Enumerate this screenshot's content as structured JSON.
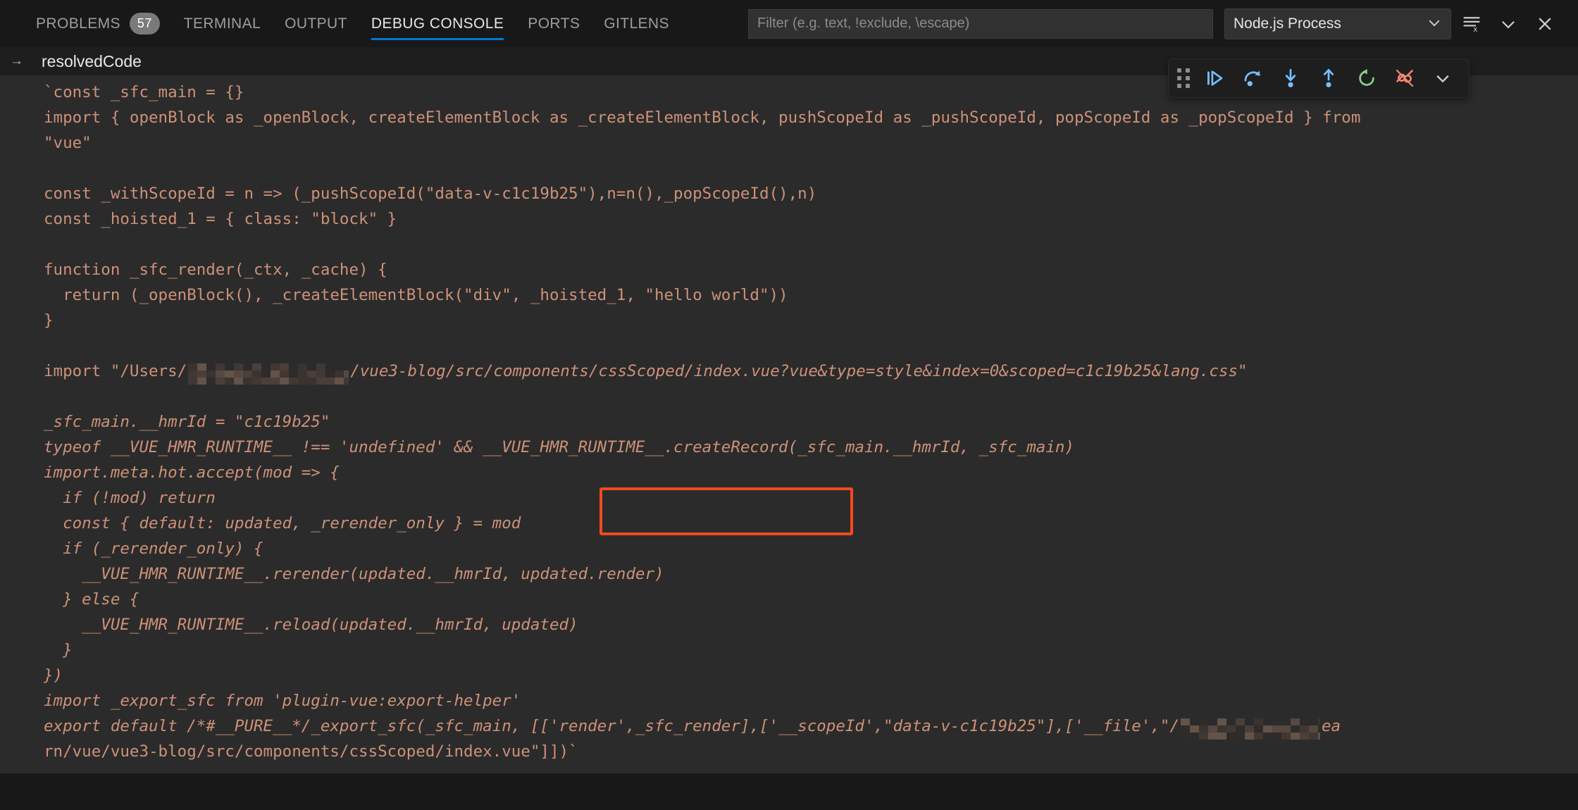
{
  "panel": {
    "tabs": [
      {
        "label": "PROBLEMS",
        "badge": "57",
        "active": false
      },
      {
        "label": "TERMINAL",
        "badge": null,
        "active": false
      },
      {
        "label": "OUTPUT",
        "badge": null,
        "active": false
      },
      {
        "label": "DEBUG CONSOLE",
        "badge": null,
        "active": true
      },
      {
        "label": "PORTS",
        "badge": null,
        "active": false
      },
      {
        "label": "GITLENS",
        "badge": null,
        "active": false
      }
    ],
    "filter": {
      "placeholder": "Filter (e.g. text, !exclude, \\escape)",
      "value": ""
    },
    "session": {
      "value": "Node.js Process",
      "chevron": "∨"
    },
    "actions": {
      "clear_console": "clear-console-icon",
      "more": "chevron-down-icon",
      "close": "close-icon"
    },
    "accent_color": "#0078d4",
    "badge_color": "#7a7a7a"
  },
  "debug_toolbar": {
    "grip": "drag-handle-icon",
    "buttons": [
      {
        "name": "continue-button",
        "title": "Continue",
        "color": "#75beff"
      },
      {
        "name": "step-over-button",
        "title": "Step Over",
        "color": "#75beff"
      },
      {
        "name": "step-into-button",
        "title": "Step Into",
        "color": "#75beff"
      },
      {
        "name": "step-out-button",
        "title": "Step Out",
        "color": "#75beff"
      },
      {
        "name": "restart-button",
        "title": "Restart",
        "color": "#89d185"
      },
      {
        "name": "disconnect-button",
        "title": "Disconnect",
        "color": "#f48771"
      },
      {
        "name": "toolbar-more-button",
        "title": "More",
        "color": "#cccccc"
      }
    ]
  },
  "console": {
    "expression": {
      "arrow": "→",
      "label": "resolvedCode"
    },
    "text_color": "#ce9178",
    "background": "#2b2b2b",
    "highlight": {
      "color": "#f4491e",
      "target": ",['__scopeId',\"data-v-c1c19b25\"]"
    },
    "lines": [
      {
        "text": "`const _sfc_main = {}",
        "italic": false
      },
      {
        "text": "import { openBlock as _openBlock, createElementBlock as _createElementBlock, pushScopeId as _pushScopeId, popScopeId as _popScopeId } from",
        "italic": false
      },
      {
        "text": "\"vue\"",
        "italic": false
      },
      {
        "text": "",
        "italic": false
      },
      {
        "text": "const _withScopeId = n => (_pushScopeId(\"data-v-c1c19b25\"),n=n(),_popScopeId(),n)",
        "italic": false
      },
      {
        "text": "const _hoisted_1 = { class: \"block\" }",
        "italic": false
      },
      {
        "text": "",
        "italic": false
      },
      {
        "text": "function _sfc_render(_ctx, _cache) {",
        "italic": false
      },
      {
        "text": "  return (_openBlock(), _createElementBlock(\"div\", _hoisted_1, \"hello world\"))",
        "italic": false
      },
      {
        "text": "}",
        "italic": false
      },
      {
        "text": "",
        "italic": false
      },
      {
        "text": "import \"/Users/",
        "italic": false,
        "redacted": true,
        "after": "/vue3-blog/src/components/cssScoped/index.vue?vue&type=style&index=0&scoped=c1c19b25&lang.css\"",
        "after_italic": true
      },
      {
        "text": "",
        "italic": false
      },
      {
        "text": "_sfc_main.__hmrId = \"c1c19b25\"",
        "italic": true
      },
      {
        "text": "typeof __VUE_HMR_RUNTIME__ !== 'undefined' && __VUE_HMR_RUNTIME__.createRecord(_sfc_main.__hmrId, _sfc_main)",
        "italic": true
      },
      {
        "text": "import.meta.hot.accept(mod => {",
        "italic": true
      },
      {
        "text": "  if (!mod) return",
        "italic": true
      },
      {
        "text": "  const { default: updated, _rerender_only } = mod",
        "italic": true
      },
      {
        "text": "  if (_rerender_only) {",
        "italic": true
      },
      {
        "text": "    __VUE_HMR_RUNTIME__.rerender(updated.__hmrId, updated.render)",
        "italic": true
      },
      {
        "text": "  } else {",
        "italic": true
      },
      {
        "text": "    __VUE_HMR_RUNTIME__.reload(updated.__hmrId, updated)",
        "italic": true
      },
      {
        "text": "  }",
        "italic": true
      },
      {
        "text": "})",
        "italic": true
      },
      {
        "text": "import _export_sfc from 'plugin-vue:export-helper'",
        "italic": true
      },
      {
        "text": "export default /*#__PURE__*/_export_sfc(_sfc_main, [['render',_sfc_render],['__scopeId',\"data-v-c1c19b25\"],['__file',\"/",
        "italic": true,
        "redacted_tail": true,
        "tail": "ea"
      },
      {
        "text": "rn/vue/vue3-blog/src/components/cssScoped/index.vue\"]])`",
        "italic": false
      }
    ]
  }
}
